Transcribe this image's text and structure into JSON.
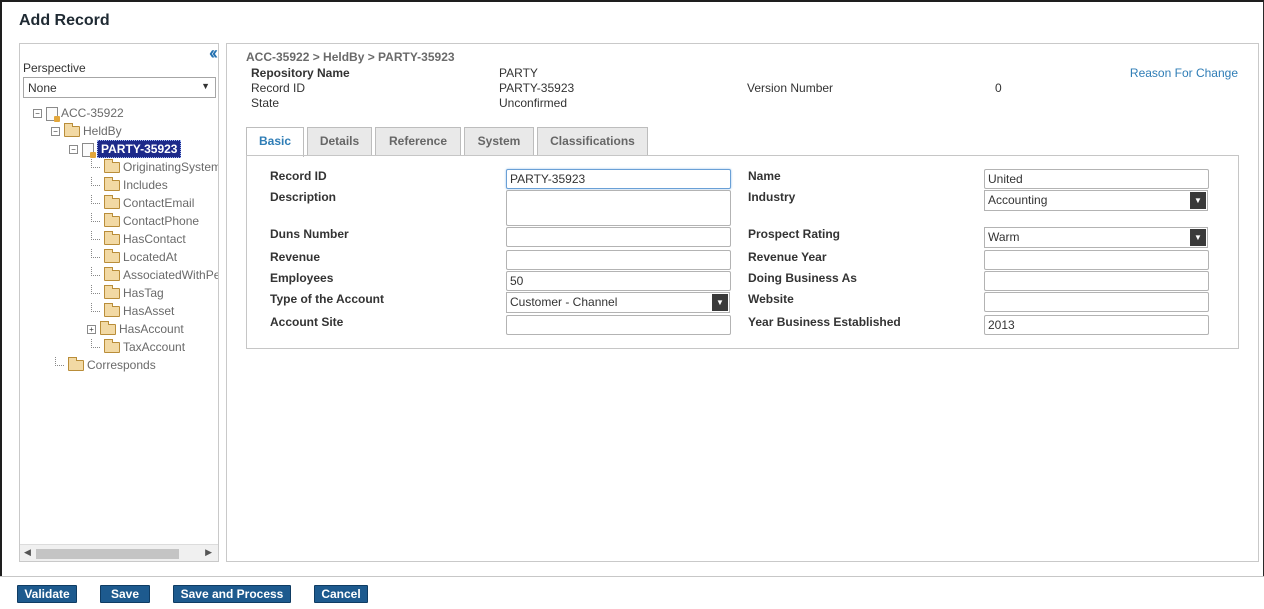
{
  "window": {
    "title": "Add Record"
  },
  "left_panel": {
    "collapse_icon": "double-chevron-left-icon",
    "perspective_label": "Perspective",
    "perspective_value": "None",
    "tree": [
      {
        "label": "ACC-35922"
      },
      {
        "label": "HeldBy"
      },
      {
        "label": "PARTY-35923"
      },
      {
        "label": "OriginatingSystem"
      },
      {
        "label": "Includes"
      },
      {
        "label": "ContactEmail"
      },
      {
        "label": "ContactPhone"
      },
      {
        "label": "HasContact"
      },
      {
        "label": "LocatedAt"
      },
      {
        "label": "AssociatedWithPe"
      },
      {
        "label": "HasTag"
      },
      {
        "label": "HasAsset"
      },
      {
        "label": "HasAccount"
      },
      {
        "label": "TaxAccount"
      },
      {
        "label": "Corresponds"
      }
    ]
  },
  "record": {
    "breadcrumb": "ACC-35922 > HeldBy > PARTY-35923",
    "repository_name_label": "Repository Name",
    "repository_name_value": "PARTY",
    "record_id_label": "Record ID",
    "record_id_value": "PARTY-35923",
    "state_label": "State",
    "state_value": "Unconfirmed",
    "version_label": "Version Number",
    "version_value": "0",
    "reason_link": "Reason For Change"
  },
  "tabs": [
    {
      "label": "Basic",
      "active": true
    },
    {
      "label": "Details",
      "active": false
    },
    {
      "label": "Reference",
      "active": false
    },
    {
      "label": "System",
      "active": false
    },
    {
      "label": "Classifications",
      "active": false
    }
  ],
  "form": {
    "record_id": {
      "label": "Record ID",
      "value": "PARTY-35923"
    },
    "description": {
      "label": "Description",
      "value": ""
    },
    "duns_number": {
      "label": "Duns Number",
      "value": ""
    },
    "revenue": {
      "label": "Revenue",
      "value": ""
    },
    "employees": {
      "label": "Employees",
      "value": "50"
    },
    "type_of_account": {
      "label": "Type of the Account",
      "value": "Customer - Channel"
    },
    "account_site": {
      "label": "Account Site",
      "value": ""
    },
    "name": {
      "label": "Name",
      "value": "United"
    },
    "industry": {
      "label": "Industry",
      "value": "Accounting"
    },
    "prospect_rating": {
      "label": "Prospect Rating",
      "value": "Warm"
    },
    "revenue_year": {
      "label": "Revenue Year",
      "value": ""
    },
    "doing_business_as": {
      "label": "Doing Business As",
      "value": ""
    },
    "website": {
      "label": "Website",
      "value": ""
    },
    "year_established": {
      "label": "Year Business Established",
      "value": "2013"
    }
  },
  "footer": {
    "validate": "Validate",
    "save": "Save",
    "save_process": "Save and Process",
    "cancel": "Cancel"
  },
  "colors": {
    "accent": "#2f7db6",
    "button": "#1d5a8e",
    "selected_node": "#1d2a8a"
  }
}
